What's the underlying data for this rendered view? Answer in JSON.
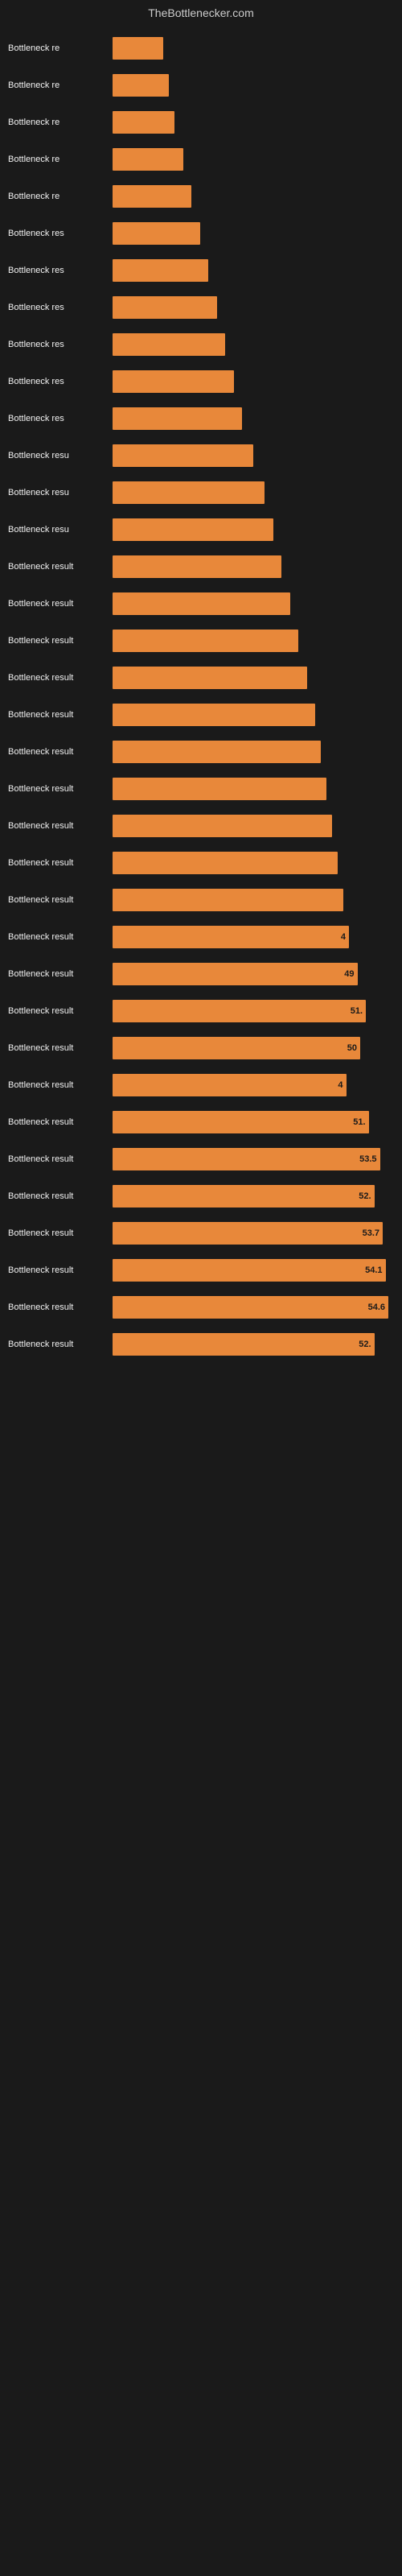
{
  "header": {
    "title": "TheBottlenecker.com"
  },
  "chart": {
    "label": "Bottleneck result",
    "bars": [
      {
        "label": "Bottleneck re",
        "value": null,
        "width": 18
      },
      {
        "label": "Bottleneck re",
        "value": null,
        "width": 20
      },
      {
        "label": "Bottleneck re",
        "value": null,
        "width": 22
      },
      {
        "label": "Bottleneck re",
        "value": null,
        "width": 25
      },
      {
        "label": "Bottleneck re",
        "value": null,
        "width": 28
      },
      {
        "label": "Bottleneck res",
        "value": null,
        "width": 31
      },
      {
        "label": "Bottleneck res",
        "value": null,
        "width": 34
      },
      {
        "label": "Bottleneck res",
        "value": null,
        "width": 37
      },
      {
        "label": "Bottleneck res",
        "value": null,
        "width": 40
      },
      {
        "label": "Bottleneck res",
        "value": null,
        "width": 43
      },
      {
        "label": "Bottleneck res",
        "value": null,
        "width": 46
      },
      {
        "label": "Bottleneck resu",
        "value": null,
        "width": 50
      },
      {
        "label": "Bottleneck resu",
        "value": null,
        "width": 54
      },
      {
        "label": "Bottleneck resu",
        "value": null,
        "width": 57
      },
      {
        "label": "Bottleneck result",
        "value": null,
        "width": 60
      },
      {
        "label": "Bottleneck result",
        "value": null,
        "width": 63
      },
      {
        "label": "Bottleneck result",
        "value": null,
        "width": 66
      },
      {
        "label": "Bottleneck result",
        "value": null,
        "width": 69
      },
      {
        "label": "Bottleneck result",
        "value": null,
        "width": 72
      },
      {
        "label": "Bottleneck result",
        "value": null,
        "width": 74
      },
      {
        "label": "Bottleneck result",
        "value": null,
        "width": 76
      },
      {
        "label": "Bottleneck result",
        "value": null,
        "width": 78
      },
      {
        "label": "Bottleneck result",
        "value": null,
        "width": 80
      },
      {
        "label": "Bottleneck result",
        "value": null,
        "width": 82
      },
      {
        "label": "Bottleneck result",
        "value": "4",
        "width": 84
      },
      {
        "label": "Bottleneck result",
        "value": "49",
        "width": 87
      },
      {
        "label": "Bottleneck result",
        "value": "51.",
        "width": 90
      },
      {
        "label": "Bottleneck result",
        "value": "50",
        "width": 88
      },
      {
        "label": "Bottleneck result",
        "value": "4",
        "width": 83
      },
      {
        "label": "Bottleneck result",
        "value": "51.",
        "width": 91
      },
      {
        "label": "Bottleneck result",
        "value": "53.5",
        "width": 95
      },
      {
        "label": "Bottleneck result",
        "value": "52.",
        "width": 93
      },
      {
        "label": "Bottleneck result",
        "value": "53.7",
        "width": 96
      },
      {
        "label": "Bottleneck result",
        "value": "54.1",
        "width": 97
      },
      {
        "label": "Bottleneck result",
        "value": "54.6",
        "width": 98
      },
      {
        "label": "Bottleneck result",
        "value": "52.",
        "width": 93
      }
    ]
  }
}
